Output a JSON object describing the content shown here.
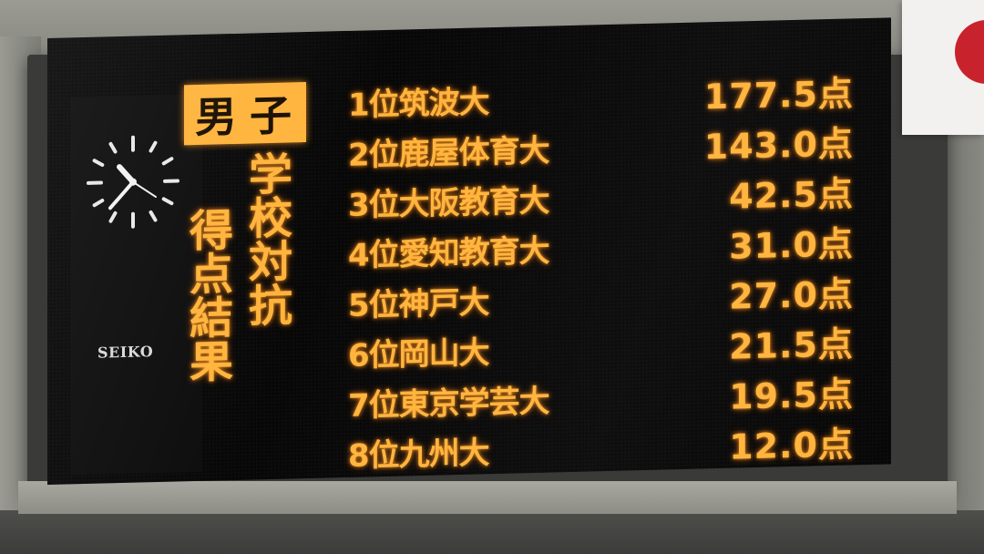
{
  "board": {
    "category": "男子",
    "title_columns": [
      "学校対抗",
      "得点結果"
    ],
    "clock_brand": "SEIKO",
    "results": [
      {
        "rank": "1位筑波大",
        "score": "177.5点"
      },
      {
        "rank": "2位鹿屋体育大",
        "score": "143.0点"
      },
      {
        "rank": "3位大阪教育大",
        "score": "42.5点"
      },
      {
        "rank": "4位愛知教育大",
        "score": "31.0点"
      },
      {
        "rank": "5位神戸大",
        "score": "27.0点"
      },
      {
        "rank": "6位岡山大",
        "score": "21.5点"
      },
      {
        "rank": "7位東京学芸大",
        "score": "19.5点"
      },
      {
        "rank": "8位九州大",
        "score": "12.0点"
      }
    ]
  },
  "colors": {
    "led_amber": "#ffb43c",
    "board_background": "#070707",
    "flag_red": "#c8232c",
    "flag_white": "#f3f1ef"
  },
  "icons": {
    "clock": "analog-clock-icon",
    "flag": "japan-flag"
  }
}
